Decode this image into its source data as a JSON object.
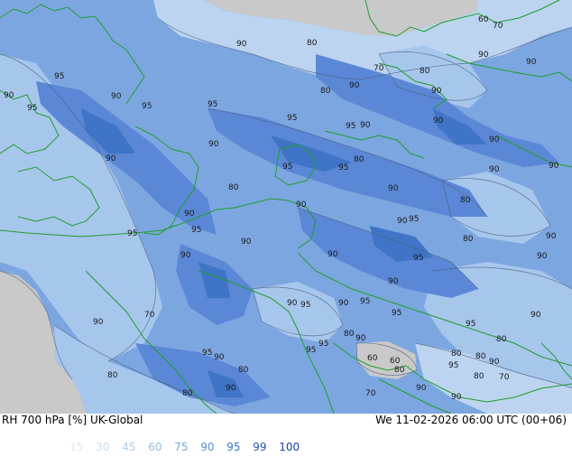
{
  "title": "RH 700 hPa [%] UK-Global",
  "valid_time": "We 11-02-2026 06:00 UTC (00+06)",
  "legend": {
    "values": [
      "15",
      "30",
      "45",
      "60",
      "75",
      "90",
      "95",
      "99",
      "100"
    ],
    "colors": [
      "#dbe9f6",
      "#c6dcf0",
      "#b0cdea",
      "#96bde4",
      "#7aa9dc",
      "#5b8fd2",
      "#3f74c6",
      "#2656b6",
      "#1a3fa0"
    ]
  },
  "colors": {
    "land_gray": "#c9c9c9",
    "base_blue": "#7ca6e0",
    "light_blue": "#a7c6ec",
    "pale_blue": "#bcd4f0",
    "dark_blue": "#5a88d6",
    "coast_green": "#1f9e2b",
    "contour": "#4a5f80"
  },
  "contour_labels": [
    {
      "text": "60"
    },
    {
      "text": "70"
    },
    {
      "text": "90"
    },
    {
      "text": "80"
    },
    {
      "text": "90"
    },
    {
      "text": "95"
    },
    {
      "text": "90"
    },
    {
      "text": "90"
    },
    {
      "text": "95"
    },
    {
      "text": "95"
    },
    {
      "text": "95"
    },
    {
      "text": "80"
    },
    {
      "text": "90"
    },
    {
      "text": "70"
    },
    {
      "text": "80"
    },
    {
      "text": "90"
    },
    {
      "text": "95"
    },
    {
      "text": "90"
    },
    {
      "text": "95"
    },
    {
      "text": "90"
    },
    {
      "text": "90"
    },
    {
      "text": "90"
    },
    {
      "text": "95"
    },
    {
      "text": "95"
    },
    {
      "text": "90"
    },
    {
      "text": "90"
    },
    {
      "text": "80"
    },
    {
      "text": "90"
    },
    {
      "text": "80"
    },
    {
      "text": "90"
    },
    {
      "text": "90"
    },
    {
      "text": "95"
    },
    {
      "text": "95"
    },
    {
      "text": "90"
    },
    {
      "text": "80"
    },
    {
      "text": "90"
    },
    {
      "text": "95"
    },
    {
      "text": "90"
    },
    {
      "text": "90"
    },
    {
      "text": "95"
    },
    {
      "text": "90"
    },
    {
      "text": "90"
    },
    {
      "text": "80"
    },
    {
      "text": "90"
    },
    {
      "text": "90"
    },
    {
      "text": "90"
    },
    {
      "text": "95"
    },
    {
      "text": "90"
    },
    {
      "text": "95"
    },
    {
      "text": "90"
    },
    {
      "text": "95"
    },
    {
      "text": "70"
    },
    {
      "text": "95"
    },
    {
      "text": "90"
    },
    {
      "text": "80"
    },
    {
      "text": "90"
    },
    {
      "text": "95"
    },
    {
      "text": "80"
    },
    {
      "text": "60"
    },
    {
      "text": "60"
    },
    {
      "text": "80"
    },
    {
      "text": "90"
    },
    {
      "text": "80"
    },
    {
      "text": "95"
    },
    {
      "text": "80"
    },
    {
      "text": "90"
    },
    {
      "text": "95"
    },
    {
      "text": "80"
    },
    {
      "text": "70"
    },
    {
      "text": "95"
    },
    {
      "text": "90"
    },
    {
      "text": "70"
    },
    {
      "text": "90"
    },
    {
      "text": "80"
    },
    {
      "text": "80"
    },
    {
      "text": "90"
    },
    {
      "text": "80"
    },
    {
      "text": "90"
    }
  ]
}
